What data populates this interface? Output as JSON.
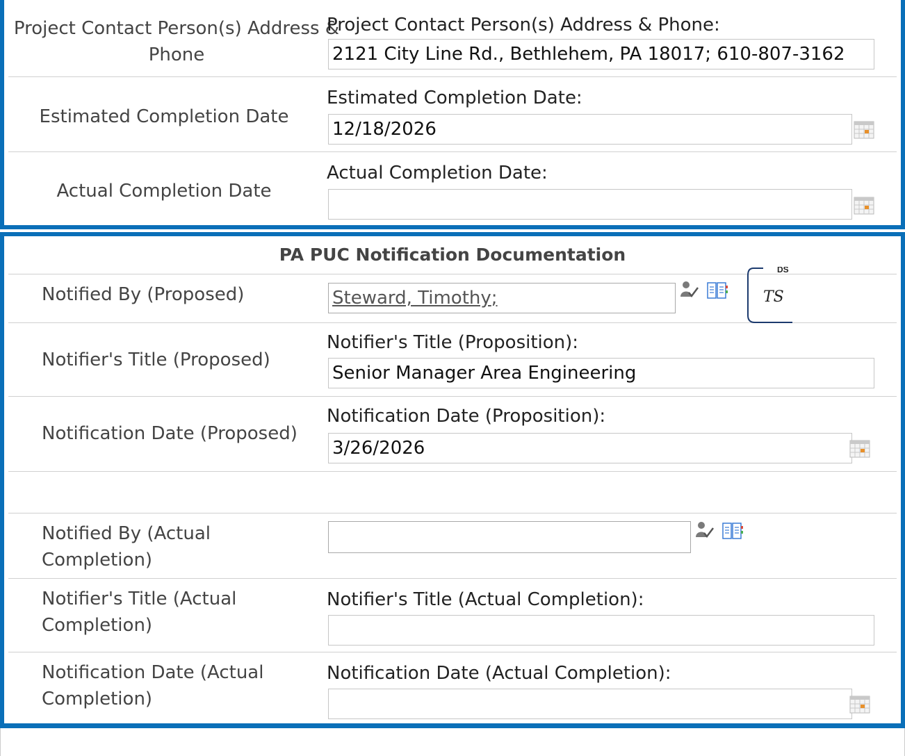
{
  "project": {
    "contact": {
      "row_label": "Project Contact Person(s) Address & Phone",
      "field_label": "Project Contact Person(s) Address & Phone:",
      "value": "2121 City Line Rd., Bethlehem, PA 18017; 610-807-3162"
    },
    "estimated": {
      "row_label": "Estimated Completion Date",
      "field_label": "Estimated Completion Date:",
      "value": "12/18/2026"
    },
    "actual": {
      "row_label": "Actual Completion Date",
      "field_label": "Actual Completion Date:",
      "value": ""
    }
  },
  "notification": {
    "section_title": "PA PUC Notification Documentation",
    "notified_by_proposed": {
      "row_label": "Notified By (Proposed)",
      "value": "Steward, Timothy",
      "suffix": ";"
    },
    "docusign": {
      "tag": "DS",
      "initials": "TS"
    },
    "title_proposed": {
      "row_label": "Notifier's Title (Proposed)",
      "field_label": "Notifier's Title (Proposition):",
      "value": "Senior Manager Area Engineering"
    },
    "date_proposed": {
      "row_label": "Notification Date (Proposed)",
      "field_label": "Notification Date (Proposition):",
      "value": "3/26/2026"
    },
    "notified_by_actual": {
      "row_label_1": "Notified By (Actual",
      "row_label_2": "Completion)",
      "value": ""
    },
    "title_actual": {
      "row_label_1": "Notifier's Title (Actual",
      "row_label_2": "Completion)",
      "field_label": "Notifier's Title (Actual Completion):",
      "value": ""
    },
    "date_actual": {
      "row_label_1": "Notification Date (Actual",
      "row_label_2": "Completion)",
      "field_label": "Notification Date (Actual Completion):",
      "value": ""
    }
  },
  "icons": {
    "calendar": "calendar-icon",
    "people_check": "check-names-icon",
    "address_book": "address-book-icon"
  },
  "colors": {
    "frame": "#0a6fb8"
  }
}
